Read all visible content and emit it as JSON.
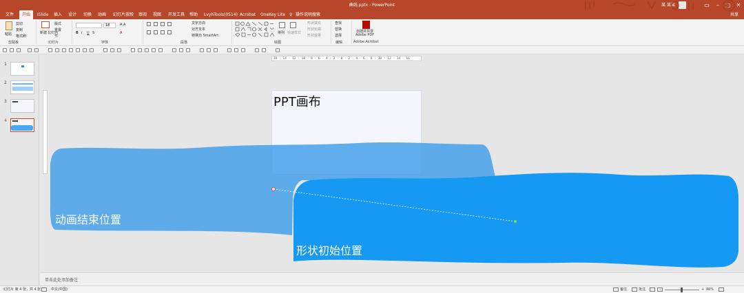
{
  "app": {
    "title": "曲线.pptx - PowerPoint",
    "user": "某 某某",
    "share": "共享"
  },
  "menu": {
    "tabs": [
      "文件",
      "开始",
      "iSlide",
      "插入",
      "设计",
      "切换",
      "动画",
      "幻灯片放映",
      "审阅",
      "视图",
      "开发工具",
      "帮助",
      "LvyhTools(0514)",
      "Acrobat",
      "OneKey Lite"
    ],
    "active_tab": "开始",
    "search_hint": "操作说明搜索"
  },
  "ribbon": {
    "groups": [
      "剪贴板",
      "幻灯片",
      "字体",
      "段落",
      "绘图",
      "编辑",
      "Adobe Acrobat"
    ],
    "clipboard": {
      "paste": "粘贴",
      "cut": "剪切",
      "copy": "复制",
      "format_painter": "格式刷"
    },
    "slides": {
      "new_slide": "新建\n幻灯片",
      "layout": "版式",
      "reset": "重置",
      "section": "节"
    },
    "font": {
      "size": "18"
    },
    "paragraph": {
      "text_direction": "文字方向",
      "align_text": "对齐文本",
      "smartart": "转换为 SmartArt"
    },
    "drawing": {
      "arrange": "排列",
      "quick_styles": "快速样式",
      "fill": "形状填充",
      "outline": "形状轮廓",
      "effects": "形状效果"
    },
    "editing": {
      "find": "查找",
      "replace": "替换",
      "select": "选择"
    },
    "acrobat": {
      "create_pdf": "创建并共享\nAdobe PDF"
    }
  },
  "ruler": {
    "labels": "16 · 14 · 12 · 10 · 8 · 6 · 4 · 2 · 0 · 2 · 4 · 6 · 8 · 10 · 12 · 14 · 16"
  },
  "thumbnails": [
    {
      "num": "1"
    },
    {
      "num": "2"
    },
    {
      "num": "3"
    },
    {
      "num": "4",
      "selected": true
    }
  ],
  "slide": {
    "title": "PPT画布"
  },
  "shapes": {
    "end_label": "动画结束位置",
    "start_label": "形状初始位置",
    "end_color": "#4aa8ee",
    "start_color": "#1699f2"
  },
  "notes": {
    "placeholder": "单击此处添加备注"
  },
  "status": {
    "slide_info": "幻灯片 第 4 张，共 4 张",
    "language": "中文(中国)",
    "notes_btn": "备注",
    "comments_btn": "批注",
    "zoom": "40%"
  }
}
